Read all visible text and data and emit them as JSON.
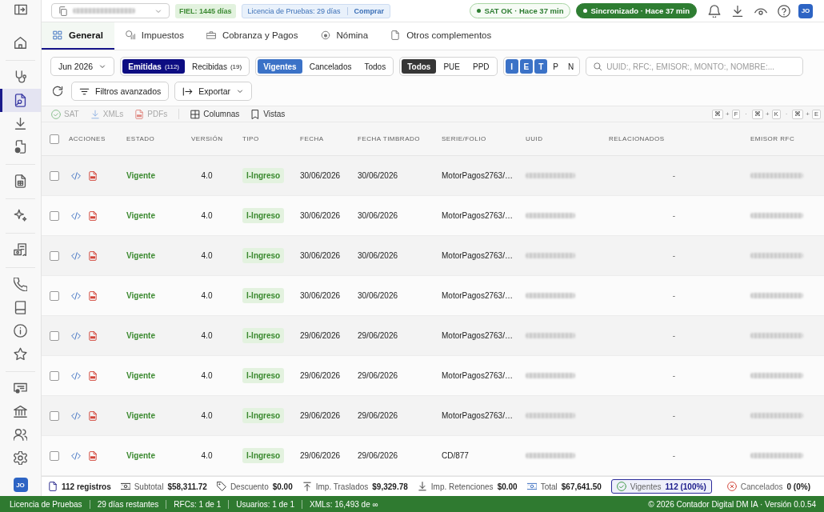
{
  "top_bar": {
    "fiel_badge": "FIEL: 1445 días",
    "license": {
      "text": "Licencia de Pruebas: 29 días",
      "action": "Comprar"
    },
    "status_pills": [
      {
        "text": "SAT OK · Hace 37 min",
        "kind": "outline"
      },
      {
        "text": "Sincronizado · Hace 37 min",
        "kind": "solid"
      }
    ],
    "user_initials": "JO"
  },
  "sidebar": {
    "groups": [
      {
        "items": [
          {
            "selected": false
          }
        ]
      },
      {
        "items": [
          {
            "selected": false
          },
          {
            "selected": true
          },
          {
            "selected": false
          },
          {
            "selected": false
          }
        ]
      },
      {
        "items": [
          {
            "selected": false
          }
        ]
      },
      {
        "items": [
          {
            "selected": false
          }
        ]
      },
      {
        "items": [
          {
            "selected": false
          }
        ]
      },
      {
        "items": [
          {
            "selected": false
          },
          {
            "selected": false
          },
          {
            "selected": false
          },
          {
            "selected": false
          }
        ]
      },
      {
        "items": [
          {
            "selected": false
          },
          {
            "selected": false
          },
          {
            "selected": false
          },
          {
            "selected": false
          }
        ]
      }
    ],
    "user_initials": "JO"
  },
  "tabs": [
    {
      "label": "General",
      "selected": true
    },
    {
      "label": "Impuestos",
      "selected": false
    },
    {
      "label": "Cobranza y Pagos",
      "selected": false
    },
    {
      "label": "Nómina",
      "selected": false
    },
    {
      "label": "Otros complementos",
      "selected": false
    }
  ],
  "filters": {
    "period": "Jun 2026",
    "direction": [
      {
        "label": "Emitidas",
        "count": "(112)",
        "selected": true
      },
      {
        "label": "Recibidas",
        "count": "(19)",
        "selected": false
      }
    ],
    "status": [
      {
        "label": "Vigentes",
        "selected": true
      },
      {
        "label": "Cancelados",
        "selected": false
      },
      {
        "label": "Todos",
        "selected": false
      }
    ],
    "payment": [
      {
        "label": "Todos",
        "selected": true
      },
      {
        "label": "PUE",
        "selected": false
      },
      {
        "label": "PPD",
        "selected": false
      }
    ],
    "types": [
      {
        "label": "I",
        "selected": true
      },
      {
        "label": "E",
        "selected": true
      },
      {
        "label": "T",
        "selected": true
      },
      {
        "label": "P",
        "selected": false
      },
      {
        "label": "N",
        "selected": false
      }
    ],
    "search": {
      "placeholder": "UUID:, RFC:, EMISOR:, MONTO:, NOMBRE:..."
    },
    "advanced_button": "Filtros avanzados",
    "export_button": "Exportar"
  },
  "toolbar": {
    "bulk_actions": [
      {
        "label": "SAT",
        "disabled": true
      },
      {
        "label": "XMLs",
        "disabled": true
      },
      {
        "label": "PDFs",
        "disabled": true
      }
    ],
    "view_actions": [
      {
        "label": "Columnas",
        "disabled": false
      },
      {
        "label": "Vistas",
        "disabled": false
      }
    ],
    "shortcuts": [
      {
        "kind": "key",
        "text": "⌘"
      },
      {
        "kind": "plus",
        "text": "+"
      },
      {
        "kind": "key",
        "text": "F"
      },
      {
        "kind": "separator",
        "text": "·"
      },
      {
        "kind": "key",
        "text": "⌘"
      },
      {
        "kind": "plus",
        "text": "+"
      },
      {
        "kind": "key",
        "text": "K"
      },
      {
        "kind": "separator",
        "text": "·"
      },
      {
        "kind": "key",
        "text": "⌘"
      },
      {
        "kind": "plus",
        "text": "+"
      },
      {
        "kind": "key",
        "text": "E"
      }
    ]
  },
  "table": {
    "select_all": {
      "checked": false
    },
    "columns": [
      "ACCIONES",
      "ESTADO",
      "VERSIÓN",
      "TIPO",
      "FECHA",
      "FECHA TIMBRADO",
      "SERIE/FOLIO",
      "UUID",
      "RELACIONADOS",
      "EMISOR RFC"
    ],
    "rows": [
      {
        "checked": false,
        "estado": "Vigente",
        "version": "4.0",
        "tipo": "I-Ingreso",
        "fecha": "30/06/2026",
        "fecha_timbrado": "30/06/2026",
        "serie_folio": "MotorPagos2763/…",
        "relacionados": "-"
      },
      {
        "checked": false,
        "estado": "Vigente",
        "version": "4.0",
        "tipo": "I-Ingreso",
        "fecha": "30/06/2026",
        "fecha_timbrado": "30/06/2026",
        "serie_folio": "MotorPagos2763/…",
        "relacionados": "-"
      },
      {
        "checked": false,
        "estado": "Vigente",
        "version": "4.0",
        "tipo": "I-Ingreso",
        "fecha": "30/06/2026",
        "fecha_timbrado": "30/06/2026",
        "serie_folio": "MotorPagos2763/…",
        "relacionados": "-"
      },
      {
        "checked": false,
        "estado": "Vigente",
        "version": "4.0",
        "tipo": "I-Ingreso",
        "fecha": "30/06/2026",
        "fecha_timbrado": "30/06/2026",
        "serie_folio": "MotorPagos2763/…",
        "relacionados": "-"
      },
      {
        "checked": false,
        "estado": "Vigente",
        "version": "4.0",
        "tipo": "I-Ingreso",
        "fecha": "29/06/2026",
        "fecha_timbrado": "29/06/2026",
        "serie_folio": "MotorPagos2763/…",
        "relacionados": "-"
      },
      {
        "checked": false,
        "estado": "Vigente",
        "version": "4.0",
        "tipo": "I-Ingreso",
        "fecha": "29/06/2026",
        "fecha_timbrado": "29/06/2026",
        "serie_folio": "MotorPagos2763/…",
        "relacionados": "-"
      },
      {
        "checked": false,
        "estado": "Vigente",
        "version": "4.0",
        "tipo": "I-Ingreso",
        "fecha": "29/06/2026",
        "fecha_timbrado": "29/06/2026",
        "serie_folio": "MotorPagos2763/…",
        "relacionados": "-"
      },
      {
        "checked": false,
        "estado": "Vigente",
        "version": "4.0",
        "tipo": "I-Ingreso",
        "fecha": "29/06/2026",
        "fecha_timbrado": "29/06/2026",
        "serie_folio": "CD/877",
        "relacionados": "-"
      }
    ]
  },
  "summary": {
    "records": "112 registros",
    "totals": [
      {
        "label": "Subtotal",
        "value": "$58,311.72"
      },
      {
        "label": "Descuento",
        "value": "$0.00"
      },
      {
        "label": "Imp. Traslados",
        "value": "$9,329.78"
      },
      {
        "label": "Imp. Retenciones",
        "value": "$0.00"
      },
      {
        "label": "Total",
        "value": "$67,641.50"
      }
    ],
    "status_filters": [
      {
        "label": "Vigentes",
        "value": "112 (100%)",
        "selected": true
      },
      {
        "label": "Cancelados",
        "value": "0 (0%)",
        "selected": false
      }
    ]
  },
  "status_bar": {
    "items": [
      "Licencia de Pruebas",
      "29 días restantes",
      "RFCs: 1 de 1",
      "Usuarios: 1 de 1",
      "XMLs: 16,493 de ∞"
    ],
    "copyright": "© 2026 Contador Digital DM IA · Versión 0.0.54"
  }
}
